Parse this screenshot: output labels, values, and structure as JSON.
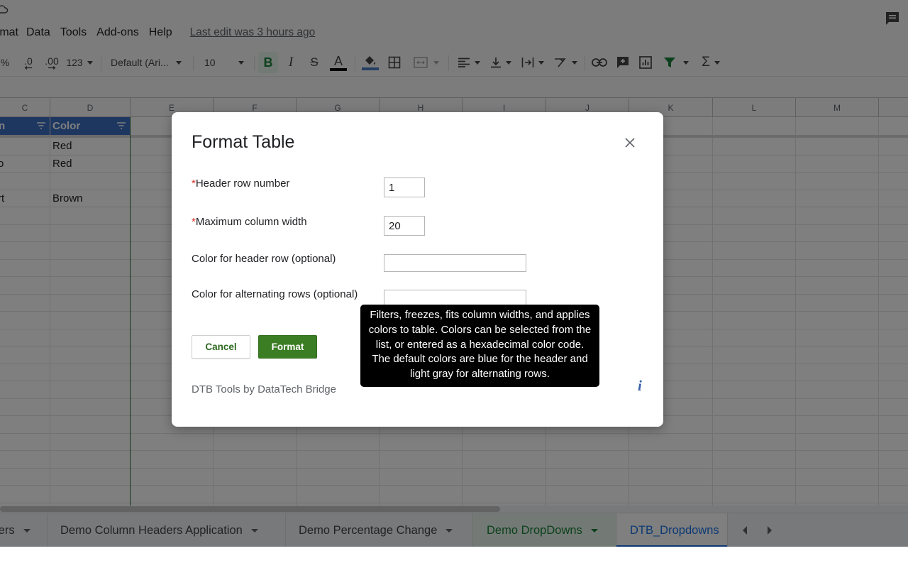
{
  "menubar": {
    "items": [
      "rmat",
      "Data",
      "Tools",
      "Add-ons",
      "Help"
    ],
    "last_edit": "Last edit was 3 hours ago"
  },
  "toolbar": {
    "percent": "%",
    "dec_decrease": ".0",
    "dec_increase": ".00",
    "more_formats": "123",
    "font": "Default (Ari...",
    "font_size": "10",
    "bold": "B",
    "italic": "I",
    "strike": "S",
    "text_color": "A",
    "sum": "Σ",
    "accent_colors": {
      "text_color_bar": "#000000",
      "fill_color_bar": "#4a80c4",
      "filter": "#188038"
    }
  },
  "grid": {
    "columns": [
      "C",
      "D",
      "E",
      "F",
      "G",
      "H",
      "I",
      "J",
      "K",
      "L",
      "M"
    ],
    "header_cells": {
      "c": "n",
      "d": "Color"
    },
    "rows": [
      {
        "c": "",
        "d": "Red"
      },
      {
        "c": "o",
        "d": "Red"
      },
      {
        "c": "",
        "d": ""
      },
      {
        "c": "rt",
        "d": "Brown"
      }
    ],
    "header_color": "#3d6fc2"
  },
  "sheet_tabs": [
    {
      "label": "lers"
    },
    {
      "label": "Demo Column Headers Application"
    },
    {
      "label": "Demo Percentage Change"
    },
    {
      "label": "Demo DropDowns"
    },
    {
      "label": "DTB_Dropdowns"
    }
  ],
  "dialog": {
    "title": "Format Table",
    "required_mark": "*",
    "fields": {
      "header_row": {
        "label": "Header row number",
        "value": "1"
      },
      "max_width": {
        "label": "Maximum column width",
        "value": "20"
      },
      "header_color": {
        "label": "Color for header row (optional)",
        "value": ""
      },
      "alt_color": {
        "label": "Color for alternating rows (optional)",
        "value": ""
      }
    },
    "cancel_label": "Cancel",
    "format_label": "Format",
    "footer": "DTB Tools by DataTech Bridge",
    "info_glyph": "i",
    "tooltip": "Filters, freezes, fits column widths, and applies colors to table. Colors can be selected from the list, or entered as a hexadecimal color code. The default colors are blue for the header and light gray for alternating rows.",
    "colors": {
      "primary_button": "#3b7d23",
      "cancel_text": "#2d6a1f",
      "required": "#d93025"
    }
  }
}
